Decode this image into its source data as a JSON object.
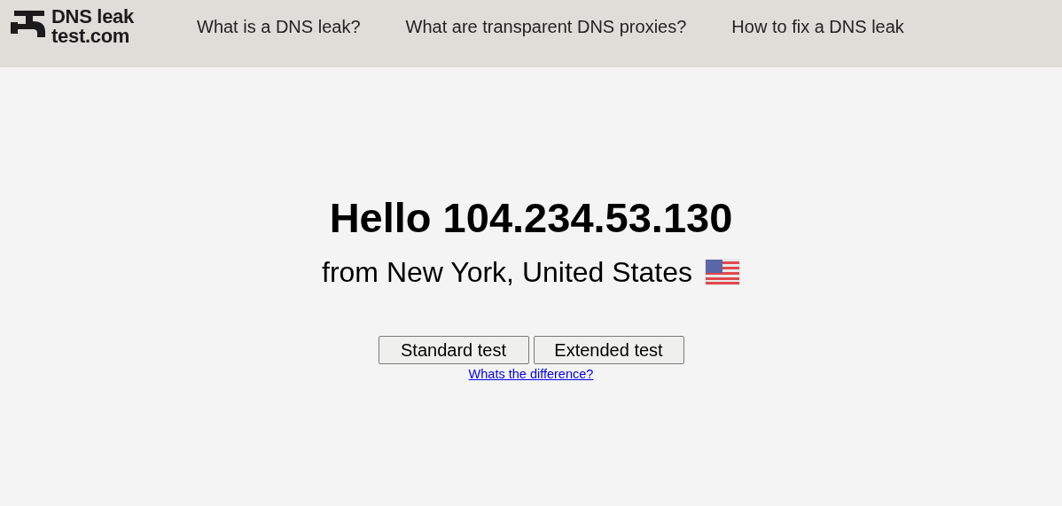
{
  "header": {
    "logo": [
      "DNS leak",
      "test.com"
    ],
    "nav": [
      {
        "label": "What is a DNS leak?"
      },
      {
        "label": "What are transparent DNS proxies?"
      },
      {
        "label": "How to fix a DNS leak"
      }
    ]
  },
  "main": {
    "greeting": "Hello 104.234.53.130",
    "location": "from New York, United States",
    "buttons": [
      "Standard test",
      "Extended test"
    ],
    "link": "Whats the difference?"
  }
}
